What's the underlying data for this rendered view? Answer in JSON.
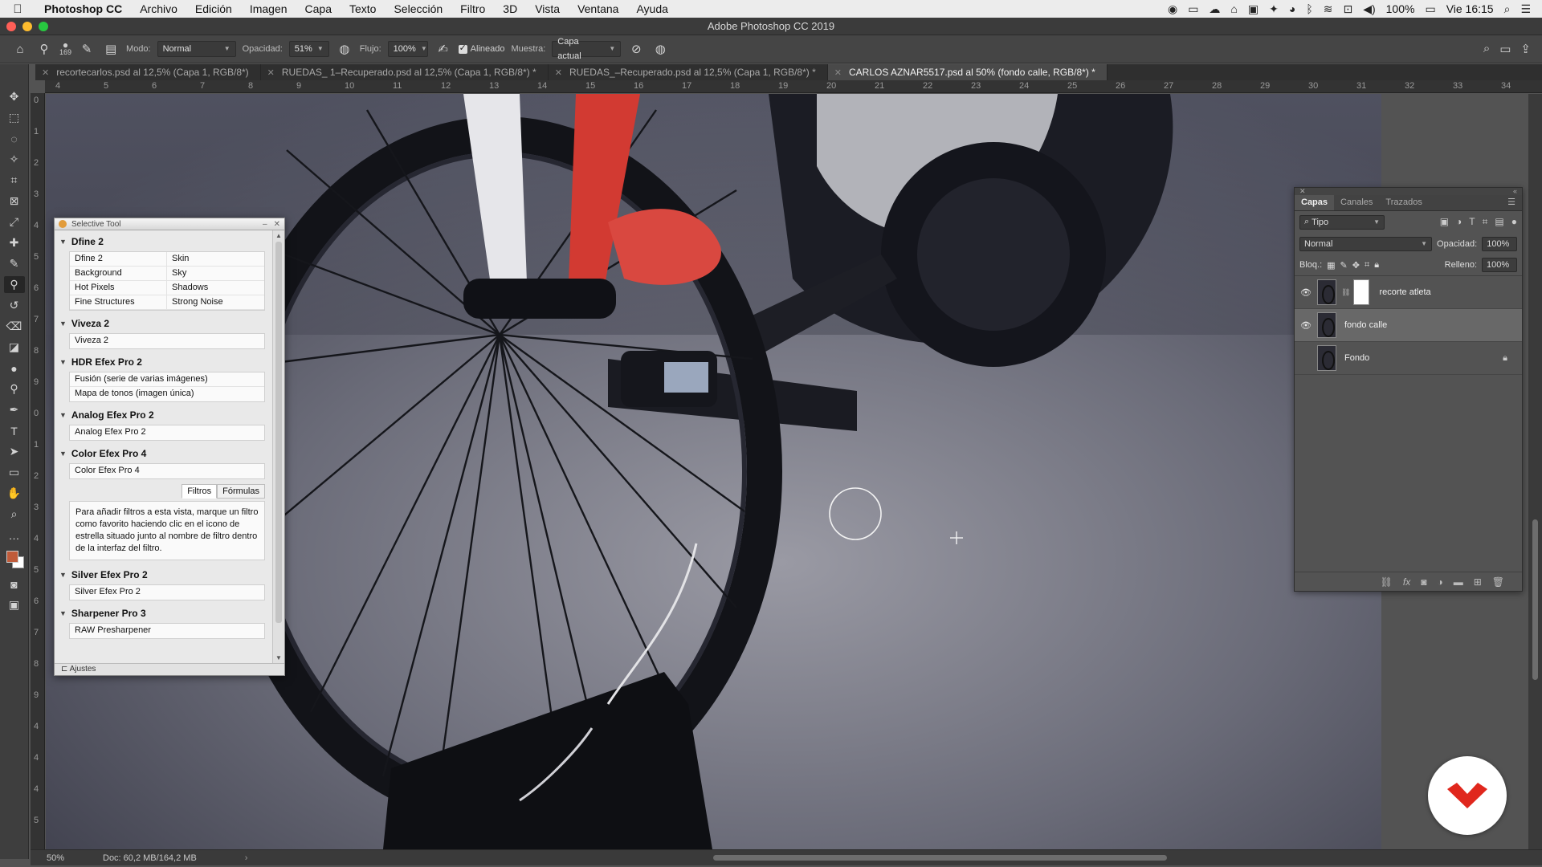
{
  "menubar": {
    "apple_icon": "apple-icon",
    "app_name": "Photoshop CC",
    "items": [
      "Archivo",
      "Edición",
      "Imagen",
      "Capa",
      "Texto",
      "Selección",
      "Filtro",
      "3D",
      "Vista",
      "Ventana",
      "Ayuda"
    ],
    "battery": "100%",
    "clock": "Vie 16:15"
  },
  "window": {
    "title": "Adobe Photoshop CC 2019",
    "light_colors": [
      "#ff5f57",
      "#febc2e",
      "#28c840"
    ]
  },
  "options": {
    "brush_size": "169",
    "mode_label": "Modo:",
    "mode_value": "Normal",
    "opacity_label": "Opacidad:",
    "opacity_value": "51%",
    "flow_label": "Flujo:",
    "flow_value": "100%",
    "aligned_label": "Alineado",
    "sample_label": "Muestra:",
    "sample_value": "Capa actual"
  },
  "tabs": [
    {
      "label": "recortecarlos.psd al 12,5% (Capa 1, RGB/8*)",
      "active": false
    },
    {
      "label": "RUEDAS_ 1–Recuperado.psd al 12,5% (Capa 1, RGB/8*) *",
      "active": false
    },
    {
      "label": "RUEDAS_–Recuperado.psd al 12,5% (Capa 1, RGB/8*) *",
      "active": false
    },
    {
      "label": "CARLOS AZNAR5517.psd al 50% (fondo calle, RGB/8*) *",
      "active": true
    }
  ],
  "ruler_top": [
    "4",
    "5",
    "6",
    "7",
    "8",
    "9",
    "10",
    "11",
    "12",
    "13",
    "14",
    "15",
    "16",
    "17",
    "18",
    "19",
    "20",
    "21",
    "22",
    "23",
    "24",
    "25",
    "26",
    "27",
    "28",
    "29",
    "30",
    "31",
    "32",
    "33",
    "34"
  ],
  "ruler_left": [
    "0",
    "1",
    "2",
    "3",
    "4",
    "5",
    "6",
    "7",
    "8",
    "9",
    "0",
    "1",
    "2",
    "3",
    "4",
    "5",
    "6",
    "7",
    "8",
    "9",
    "4",
    "4",
    "4",
    "5"
  ],
  "selective": {
    "title": "Selective Tool",
    "sections": [
      {
        "name": "Dfine 2",
        "kind": "grid",
        "items": [
          "Dfine 2",
          "Skin",
          "Background",
          "Sky",
          "Hot Pixels",
          "Shadows",
          "Fine Structures",
          "Strong Noise"
        ]
      },
      {
        "name": "Viveza 2",
        "kind": "list",
        "items": [
          "Viveza 2"
        ]
      },
      {
        "name": "HDR Efex Pro 2",
        "kind": "list",
        "items": [
          "Fusión (serie de varias imágenes)",
          "Mapa de tonos (imagen única)"
        ]
      },
      {
        "name": "Analog Efex Pro 2",
        "kind": "list",
        "items": [
          "Analog Efex Pro 2"
        ]
      },
      {
        "name": "Color Efex Pro 4",
        "kind": "list",
        "items": [
          "Color Efex Pro 4"
        ]
      }
    ],
    "filter_tabs": [
      "Filtros",
      "Fórmulas"
    ],
    "info_text": "Para añadir filtros a esta vista, marque un filtro como favorito haciendo clic en el icono de estrella situado junto al nombre de filtro dentro de la interfaz del filtro.",
    "sections_after": [
      {
        "name": "Silver Efex Pro 2",
        "items": [
          "Silver Efex Pro 2"
        ]
      },
      {
        "name": "Sharpener Pro 3",
        "items": [
          "RAW Presharpener"
        ]
      }
    ],
    "footer": "Ajustes"
  },
  "layers_panel": {
    "tabs": [
      "Capas",
      "Canales",
      "Trazados"
    ],
    "filter_value": "Tipo",
    "blend_mode": "Normal",
    "opacity_label": "Opacidad:",
    "opacity_value": "100%",
    "lock_label": "Bloq.:",
    "fill_label": "Relleno:",
    "fill_value": "100%",
    "layers": [
      {
        "name": "recorte atleta",
        "visible": true,
        "selected": false,
        "has_mask": true,
        "locked": false
      },
      {
        "name": "fondo calle",
        "visible": true,
        "selected": true,
        "has_mask": false,
        "locked": false
      },
      {
        "name": "Fondo",
        "visible": false,
        "selected": false,
        "has_mask": false,
        "locked": true
      }
    ]
  },
  "status": {
    "zoom": "50%",
    "doc": "Doc: 60,2 MB/164,2 MB",
    "arrow": "›"
  },
  "colors": {
    "foreground": "#c05b3a",
    "background": "#ffffff",
    "brand": "#e0271d"
  }
}
